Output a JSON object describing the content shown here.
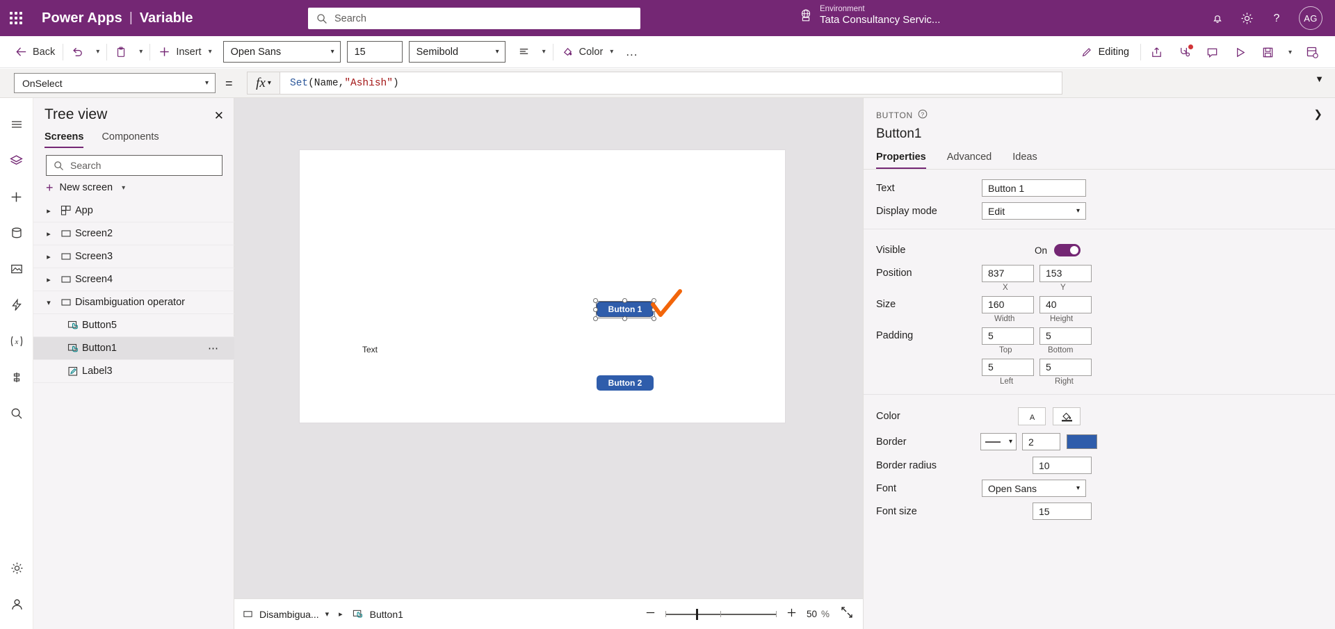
{
  "topbar": {
    "waffle": "app-launcher",
    "brand": "Power Apps",
    "separator": "|",
    "app_name": "Variable",
    "search_placeholder": "Search",
    "environment_label": "Environment",
    "environment_name": "Tata Consultancy Servic...",
    "avatar_initials": "AG",
    "brand_color": "#742774"
  },
  "commandbar": {
    "back": "Back",
    "insert": "Insert",
    "font_family": "Open Sans",
    "font_size": "15",
    "font_weight": "Semibold",
    "color": "Color",
    "more": "...",
    "editing": "Editing"
  },
  "formulabar": {
    "property": "OnSelect",
    "equals": "=",
    "fx": "fx",
    "formula_fn": "Set",
    "formula_open": "(Name, ",
    "formula_string": "\"Ashish\"",
    "formula_close": ")",
    "full_formula": "Set(Name, \"Ashish\")"
  },
  "treeview": {
    "title": "Tree view",
    "tabs": [
      {
        "label": "Screens",
        "active": true
      },
      {
        "label": "Components",
        "active": false
      }
    ],
    "search_placeholder": "Search",
    "new_screen": "New screen",
    "items": [
      {
        "label": "App",
        "icon": "app-icon",
        "expanded": false,
        "indent": 0,
        "selected": false
      },
      {
        "label": "Screen2",
        "icon": "screen-icon",
        "expanded": false,
        "indent": 0,
        "selected": false
      },
      {
        "label": "Screen3",
        "icon": "screen-icon",
        "expanded": false,
        "indent": 0,
        "selected": false
      },
      {
        "label": "Screen4",
        "icon": "screen-icon",
        "expanded": false,
        "indent": 0,
        "selected": false
      },
      {
        "label": "Disambiguation operator",
        "icon": "screen-icon",
        "expanded": true,
        "indent": 0,
        "selected": false
      },
      {
        "label": "Button5",
        "icon": "button-icon",
        "expanded": null,
        "indent": 1,
        "selected": false
      },
      {
        "label": "Button1",
        "icon": "button-icon",
        "expanded": null,
        "indent": 1,
        "selected": true
      },
      {
        "label": "Label3",
        "icon": "label-icon",
        "expanded": null,
        "indent": 1,
        "selected": false
      }
    ]
  },
  "canvas": {
    "button1_text": "Button 1",
    "button2_text": "Button 2",
    "label_text": "Text",
    "button_fill": "#2f5dab",
    "annotation": "orange-check-mark"
  },
  "bottombar": {
    "screen_name": "Disambigua...",
    "control_name": "Button1",
    "zoom_value": "50",
    "zoom_unit": "%"
  },
  "properties": {
    "kind": "BUTTON",
    "name": "Button1",
    "tabs": [
      {
        "label": "Properties",
        "active": true
      },
      {
        "label": "Advanced",
        "active": false
      },
      {
        "label": "Ideas",
        "active": false
      }
    ],
    "text_label": "Text",
    "text_value": "Button 1",
    "display_mode_label": "Display mode",
    "display_mode_value": "Edit",
    "visible_label": "Visible",
    "visible_state": "On",
    "position_label": "Position",
    "position_x": "837",
    "position_y": "153",
    "position_x_caption": "X",
    "position_y_caption": "Y",
    "size_label": "Size",
    "size_width": "160",
    "size_height": "40",
    "size_width_caption": "Width",
    "size_height_caption": "Height",
    "padding_label": "Padding",
    "padding_top": "5",
    "padding_bottom": "5",
    "padding_left": "5",
    "padding_right": "5",
    "padding_top_caption": "Top",
    "padding_bottom_caption": "Bottom",
    "padding_left_caption": "Left",
    "padding_right_caption": "Right",
    "color_label": "Color",
    "border_label": "Border",
    "border_width": "2",
    "border_color": "#2f5dab",
    "border_radius_label": "Border radius",
    "border_radius_value": "10",
    "font_label": "Font",
    "font_value": "Open Sans",
    "font_size_label": "Font size",
    "font_size_value": "15"
  }
}
